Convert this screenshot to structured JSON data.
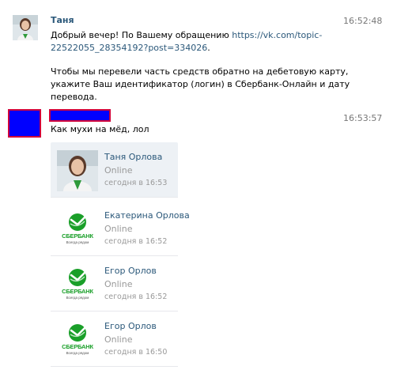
{
  "message1": {
    "author": "Таня",
    "time": "16:52:48",
    "line1_prefix": "Добрый вечер! По Вашему обращению ",
    "link_part1": "https://vk.com/topic-",
    "link_part2": "22522055_28354192?post=334026",
    "line2_suffix": ".",
    "para2_line1": "Чтобы мы перевели часть средств обратно на дебетовую карту,",
    "para2_line2": "укажите Ваш идентификатор (логин) в Сбербанк-Онлайн и дату",
    "para2_line3": "перевода."
  },
  "message2": {
    "time": "16:53:57",
    "text": "Как мухи на мёд, лол"
  },
  "contacts": [
    {
      "name": "Таня Орлова",
      "status": "Online",
      "seen": "сегодня в 16:53",
      "avatar": "photo-avatar"
    },
    {
      "name": "Екатерина Орлова",
      "status": "Online",
      "seen": "сегодня в 16:52",
      "avatar": "sberbank-logo"
    },
    {
      "name": "Егор Орлов",
      "status": "Online",
      "seen": "сегодня в 16:52",
      "avatar": "sberbank-logo"
    },
    {
      "name": "Егор Орлов",
      "status": "Online",
      "seen": "сегодня в 16:50",
      "avatar": "sberbank-logo"
    }
  ],
  "sberbank": {
    "logo_text": "СБЕРБАНК",
    "slogan": "Всегда рядом",
    "color": "#1a9f29"
  },
  "colors": {
    "link": "#2b587a",
    "redaction_fill": "#0000ff",
    "redaction_border": "#d0003a"
  }
}
